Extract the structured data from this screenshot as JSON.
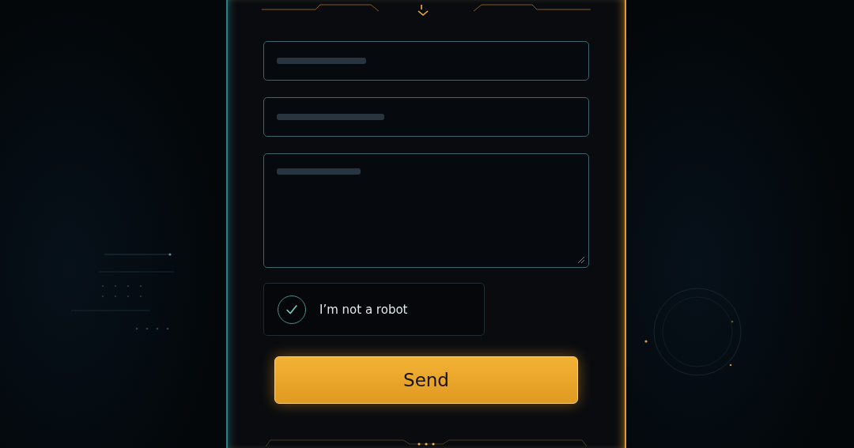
{
  "form": {
    "fields": [
      {
        "kind": "line"
      },
      {
        "kind": "line"
      },
      {
        "kind": "area"
      }
    ],
    "captcha": {
      "label": "I’m not a robot",
      "checked": true
    },
    "submit": {
      "label": "Send"
    }
  }
}
